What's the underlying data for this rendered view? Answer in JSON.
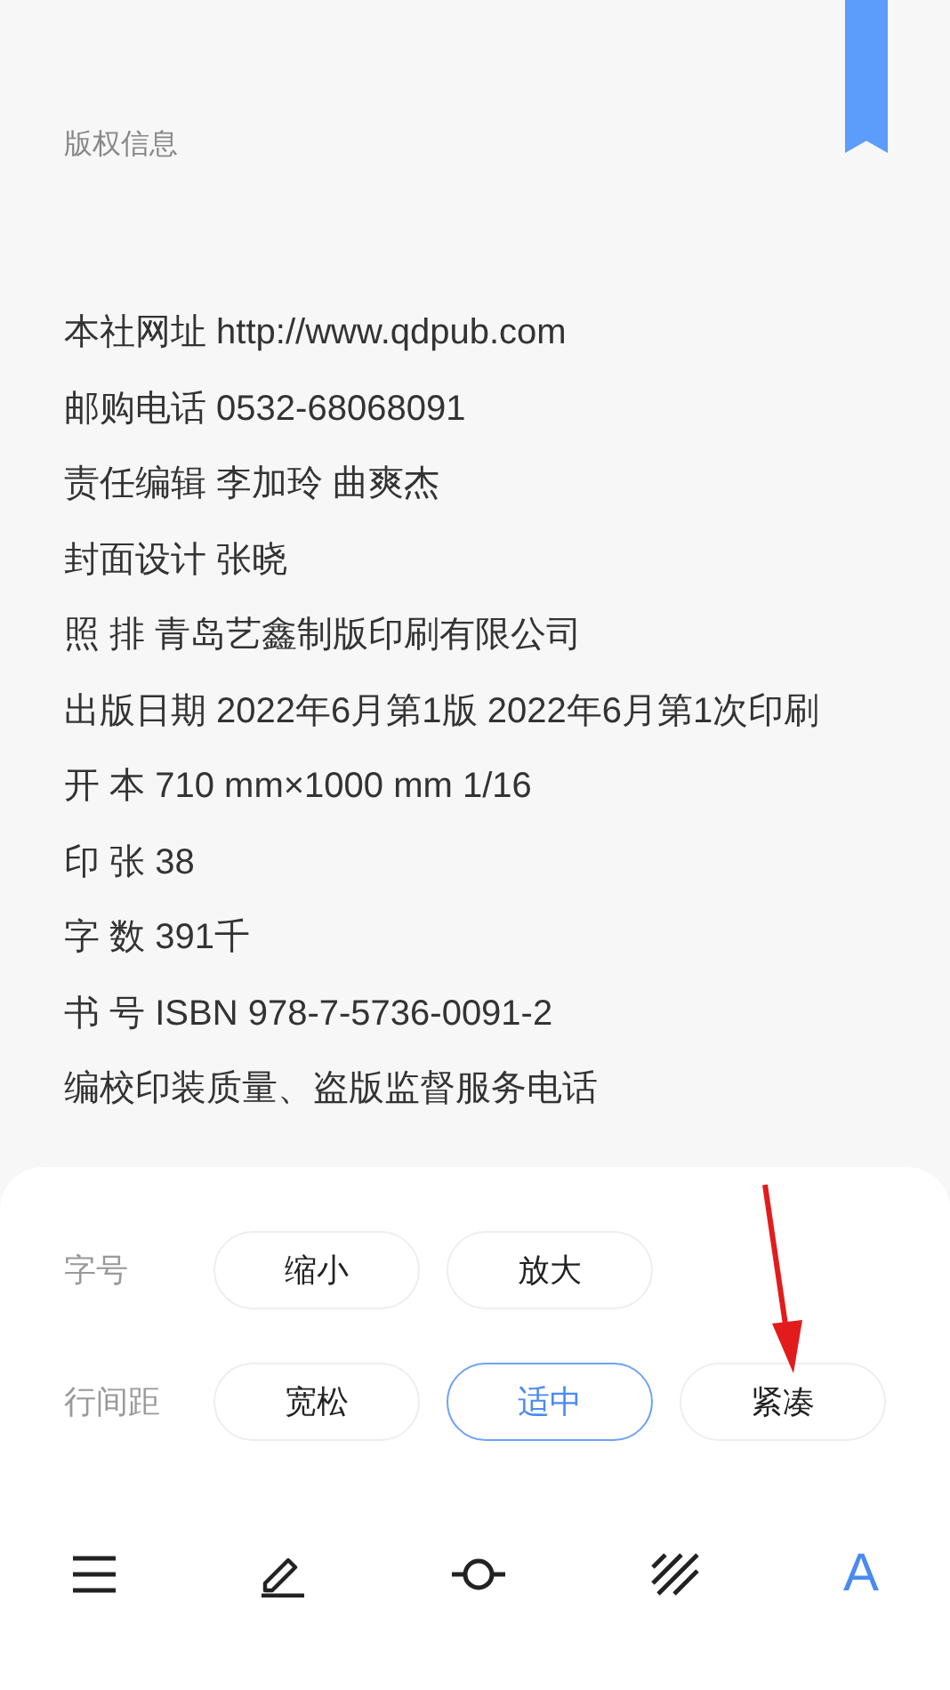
{
  "section_title": "版权信息",
  "lines": [
    "本社网址 http://www.qdpub.com",
    "邮购电话 0532-68068091",
    "责任编辑 李加玲 曲爽杰",
    "封面设计 张晓",
    "照 排 青岛艺鑫制版印刷有限公司",
    "出版日期  2022年6月第1版  2022年6月第1次印刷",
    "开 本 710 mm×1000 mm 1/16",
    "印 张 38",
    "字 数 391千",
    "书 号 ISBN 978-7-5736-0091-2",
    "编校印装质量、盗版监督服务电话"
  ],
  "settings": [
    {
      "label": "字号",
      "options": [
        {
          "label": "缩小",
          "selected": false
        },
        {
          "label": "放大",
          "selected": false
        }
      ]
    },
    {
      "label": "行间距",
      "options": [
        {
          "label": "宽松",
          "selected": false
        },
        {
          "label": "适中",
          "selected": true
        },
        {
          "label": "紧凑",
          "selected": false
        }
      ]
    }
  ],
  "toolbar": [
    {
      "kind": "menu",
      "selected": false
    },
    {
      "kind": "pen",
      "selected": false
    },
    {
      "kind": "progress",
      "selected": false
    },
    {
      "kind": "brightness",
      "selected": false
    },
    {
      "kind": "font",
      "glyph": "A",
      "selected": true
    }
  ]
}
